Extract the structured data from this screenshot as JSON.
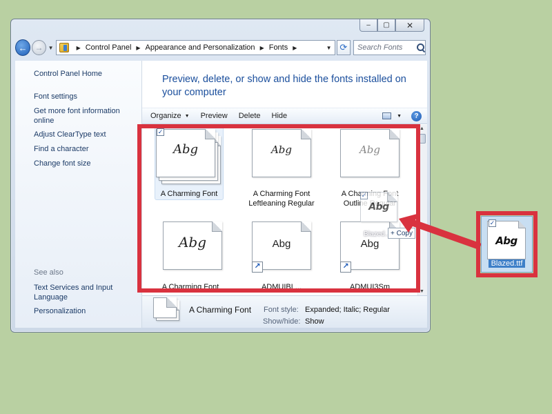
{
  "window": {
    "controls": {
      "minimize": "–",
      "maximize": "▢",
      "close": "✕"
    }
  },
  "nav": {
    "back": "←",
    "forward": "→",
    "history": "▼",
    "breadcrumbs": [
      "Control Panel",
      "Appearance and Personalization",
      "Fonts"
    ],
    "separator": "▶",
    "dropdown": "▼",
    "refresh": "⟳",
    "search_placeholder": "Search Fonts"
  },
  "sidebar": {
    "links": [
      "Control Panel Home",
      "Font settings",
      "Get more font information online",
      "Adjust ClearType text",
      "Find a character",
      "Change font size"
    ],
    "see_also_heading": "See also",
    "see_also_links": [
      "Text Services and Input Language",
      "Personalization"
    ]
  },
  "content": {
    "title": "Preview, delete, or show and hide the fonts installed on your computer"
  },
  "toolbar": {
    "organize": "Organize",
    "organize_caret": "▼",
    "preview": "Preview",
    "delete": "Delete",
    "hide": "Hide",
    "view_caret": "▼",
    "help": "?"
  },
  "fonts": [
    {
      "label": "A Charming Font",
      "sample": "Abg",
      "selected": true,
      "checked": true,
      "checkmark": "✓"
    },
    {
      "label": "A Charming Font Leftleaning Regular",
      "sample": "Abg"
    },
    {
      "label": "A Charming Font Outline Regular",
      "sample": "Abg"
    },
    {
      "label": "A Charming Font",
      "sample": "Abg"
    },
    {
      "label": "ADMUIBL...",
      "sample": "Abg",
      "shortcut": true,
      "shortcut_glyph": "↗"
    },
    {
      "label": "ADMUI3Sm",
      "sample": "Abg",
      "shortcut": true,
      "shortcut_glyph": "↗"
    }
  ],
  "scrollbar": {
    "up": "▲",
    "down": "▼"
  },
  "details": {
    "name": "A Charming Font",
    "font_style_label": "Font style:",
    "font_style_value": "Expanded; Italic; Regular",
    "showhide_label": "Show/hide:",
    "showhide_value": "Show"
  },
  "drag": {
    "ghost_sample": "Abg",
    "ghost_label": "Blazed...",
    "ghost_check": "✓",
    "copy_text": "+ Copy"
  },
  "desktop_file": {
    "sample": "Abg",
    "label": "Blazed.ttf",
    "check": "✓"
  },
  "colors": {
    "highlight_red": "#d9323f",
    "background": "#b9d0a2",
    "link_blue": "#1b3a66",
    "title_blue": "#1a4e9c"
  }
}
